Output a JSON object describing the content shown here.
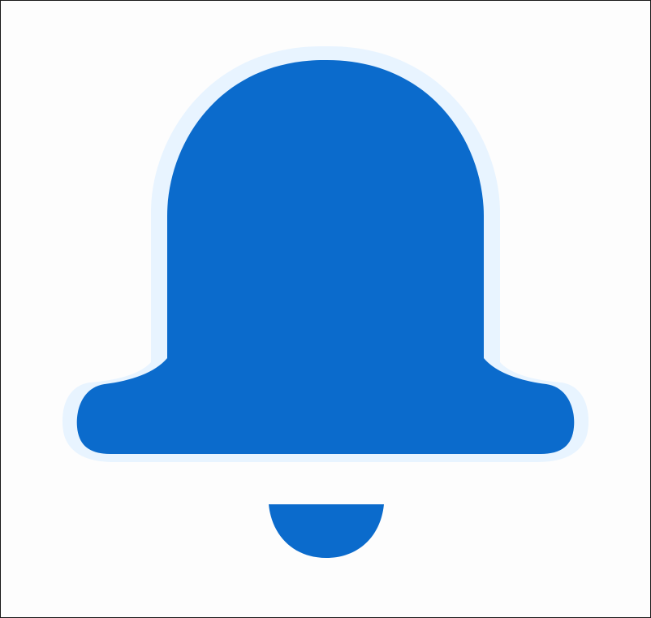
{
  "icon": {
    "name": "bell-icon",
    "color": "#0b6bcc",
    "halo_color": "#e8f4ff",
    "background": "#fdfdfd",
    "border_color": "#1a1a1a"
  }
}
